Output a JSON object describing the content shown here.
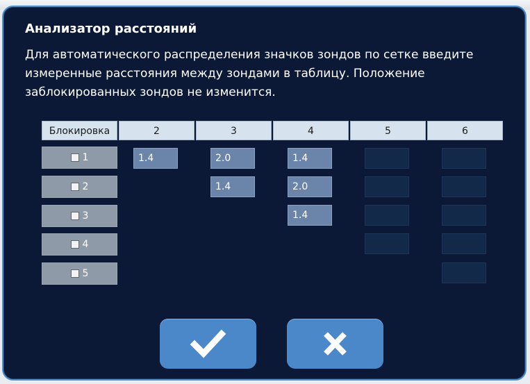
{
  "dialog": {
    "title": "Анализатор расстояний",
    "description": "Для автоматического распределения значков зондов по сетке введите измеренные расстояния между зондами в таблицу. Положение заблокированных зондов не изменится."
  },
  "table": {
    "lock_header": "Блокировка",
    "column_headers": [
      "2",
      "3",
      "4",
      "5",
      "6"
    ],
    "rows": [
      {
        "probe": "1",
        "locked": false,
        "distances": {
          "2": "1.4",
          "3": "2.0",
          "4": "1.4",
          "5": "",
          "6": ""
        }
      },
      {
        "probe": "2",
        "locked": false,
        "distances": {
          "3": "1.4",
          "4": "2.0",
          "5": "",
          "6": ""
        }
      },
      {
        "probe": "3",
        "locked": false,
        "distances": {
          "4": "1.4",
          "5": "",
          "6": ""
        }
      },
      {
        "probe": "4",
        "locked": false,
        "distances": {
          "5": "",
          "6": ""
        }
      },
      {
        "probe": "5",
        "locked": false,
        "distances": {
          "6": ""
        }
      }
    ]
  },
  "buttons": {
    "confirm_icon": "check-icon",
    "cancel_icon": "close-icon"
  },
  "colors": {
    "dialog_background": "#0b1836",
    "dialog_border": "#4f8fce",
    "button": "#4b88c9",
    "filled_input": "#6b85aa",
    "empty_input": "#13294a",
    "header_cell": "#d6e3ee",
    "lock_cell": "#8e9aa8"
  }
}
